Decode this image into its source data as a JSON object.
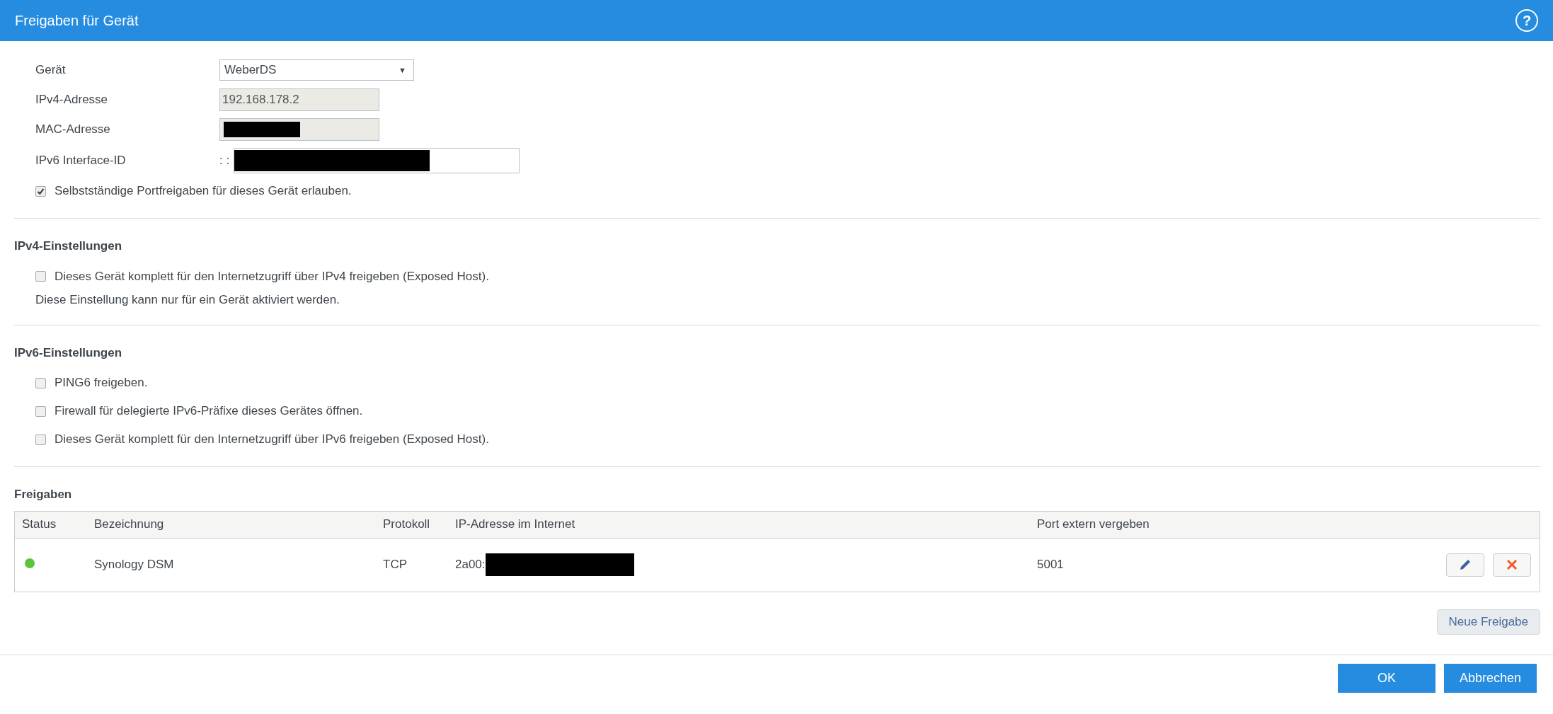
{
  "dialog": {
    "title": "Freigaben für Gerät",
    "help": "?"
  },
  "device": {
    "fields": [
      {
        "label": "Gerät",
        "kind": "select",
        "value": "WeberDS",
        "caret": "▼",
        "redacted": false
      },
      {
        "label": "IPv4-Adresse",
        "kind": "readonly",
        "value": "192.168.178.2",
        "redacted": false
      },
      {
        "label": "MAC-Adresse",
        "kind": "readonly",
        "redacted": true
      },
      {
        "label": "IPv6 Interface-ID",
        "kind": "ipv6",
        "prefix": ": :",
        "redacted": true
      }
    ],
    "options": [
      {
        "label": "Selbstständige Portfreigaben für dieses Gerät erlauben.",
        "checked": true
      }
    ]
  },
  "sections": [
    {
      "title": "IPv4-Einstellungen",
      "options": [
        {
          "label": "Dieses Gerät komplett für den Internetzugriff über IPv4 freigeben (Exposed Host).",
          "checked": false
        }
      ],
      "note": "Diese Einstellung kann nur für ein Gerät aktiviert werden."
    },
    {
      "title": "IPv6-Einstellungen",
      "options": [
        {
          "label": "PING6 freigeben.",
          "checked": false
        },
        {
          "label": "Firewall für delegierte IPv6-Präfixe dieses Gerätes öffnen.",
          "checked": false
        },
        {
          "label": "Dieses Gerät komplett für den Internetzugriff über IPv6 freigeben (Exposed Host).",
          "checked": false
        }
      ]
    }
  ],
  "shares": {
    "title": "Freigaben",
    "columns": [
      "Status",
      "Bezeichnung",
      "Protokoll",
      "IP-Adresse im Internet",
      "Port extern vergeben"
    ],
    "rows": [
      {
        "color": "#5cc43a",
        "name": "Synology DSM",
        "protocol": "TCP",
        "ip": "2a00:",
        "ip_redacted": true,
        "port": "5001"
      }
    ],
    "new_button": "Neue Freigabe"
  },
  "buttons": [
    "OK",
    "Abbrechen"
  ]
}
